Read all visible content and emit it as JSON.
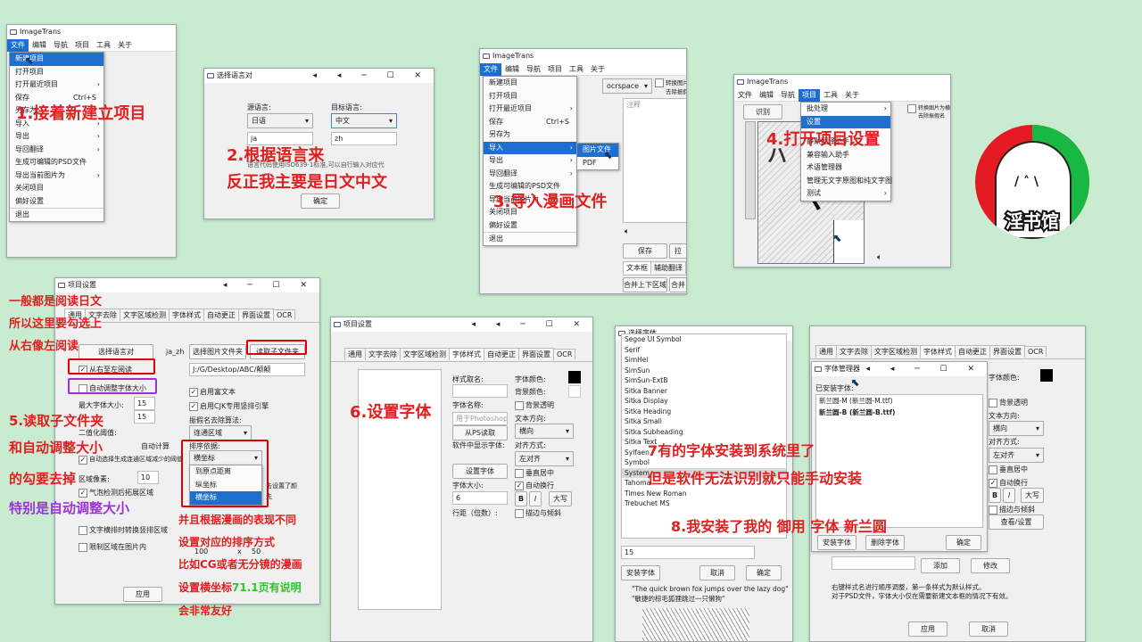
{
  "colors": {
    "background": "#c9ecd0",
    "annotation_red": "#e02020",
    "annotation_purple": "#9b30e0",
    "annotation_green": "#28c828",
    "menu_highlight": "#1e6fd0",
    "logo_red": "#e51b23",
    "logo_green": "#19b843"
  },
  "app": {
    "title": "ImageTrans"
  },
  "menubar": {
    "file": "文件",
    "edit": "编辑",
    "nav": "导航",
    "project": "项目",
    "tools": "工具",
    "about": "关于"
  },
  "file_menu": {
    "new_project": "新建项目",
    "open_project": "打开项目",
    "open_recent": "打开最近项目",
    "save": "保存",
    "save_shortcut": "Ctrl+S",
    "save_as": "另存为",
    "import": "导入",
    "export": "导出",
    "export_translation": "导回翻译",
    "gen_psd": "生成可编辑的PSD文件",
    "export_current_image": "导出当前图片为",
    "close_project": "关闭项目",
    "preferences": "偏好设置",
    "exit": "退出"
  },
  "import_submenu": {
    "image_file": "图片文件",
    "pdf": "PDF"
  },
  "project_menu": {
    "batch": "批处理",
    "settings": "设置",
    "static_helper": "静默翻译助手",
    "compat_helper": "兼容输入助手",
    "glossary": "术语管理器",
    "manage_no_text": "管理无文字原图和纯文字图",
    "test": "测试"
  },
  "lang_dialog": {
    "title": "选择语言对",
    "src_label": "源语言:",
    "tgt_label": "目标语言:",
    "src_value": "日语",
    "src_code": "ja",
    "tgt_value": "中文",
    "tgt_code": "zh",
    "hint_tail": "可以自行输入对应代",
    "hint_head": "语言代码使用ISO639-1标准,",
    "ok": "确定"
  },
  "win3": {
    "engine": "ocrspace",
    "chk1": "转换图片为",
    "chk2": "去除振假名",
    "note_label": "注释",
    "save_btn": "保存",
    "other_btn": "拉",
    "tab_textbox": "文本框",
    "tab_assist": "辅助翻译",
    "merge_btn": "合并上下区域",
    "merge2": "合并"
  },
  "win4": {
    "recognize": "识别",
    "chk1": "转换图片为横排",
    "chk2": "去除振假名",
    "chk3": "使用中",
    "chk4": "去除背"
  },
  "settings": {
    "title": "项目设置",
    "tabs": [
      "通用",
      "文字去除",
      "文字区域检测",
      "字体样式",
      "自动更正",
      "界面设置",
      "OCR"
    ],
    "select_lang_btn": "选择语言对",
    "lang_pair": "ja_zh",
    "select_folder_btn": "选择图片文件夹",
    "read_subfolder_btn": "读取子文件夹",
    "path": "J:/G/Desktop/ABC/颠颠",
    "rtl": "从右至左阅读",
    "auto_resize": "自动调整字体大小",
    "max_font": "最大字体大小:",
    "max_font_val": "15",
    "min_font_val": "15",
    "rich_text": "启用富文本",
    "cjk_vertical": "启用CJK专用竖排引擎",
    "sort_label": "振假名去除算法:",
    "binarize": "二值化阈值:",
    "auto_calc": "自动计算",
    "connected": "连通区域",
    "auto_choose": "自动选择生成连通区域减少的阈值",
    "sort_by": "排序依据:",
    "sort_options": [
      "横坐标",
      "到原点距离",
      "纵坐标",
      "横坐标"
    ],
    "region_px": "区域像素:",
    "region_val": "10",
    "bubble": "气泡检测后拓展区域",
    "textbox_convert": "文字横排时转换竖排区域",
    "limit_region": "限制区域在图片内",
    "apply": "应用",
    "val_100": "100",
    "val_x": "x",
    "val_50": "50",
    "extra_note": "击设置了颜",
    "extra_note2": "先"
  },
  "font_settings": {
    "style_name": "样式取名:",
    "font_color": "字体颜色:",
    "bg_color": "背景颜色:",
    "font_name": "字体名称:",
    "transparent_bg": "背景透明",
    "for_photoshop": "用于Photoshop",
    "text_dir": "文本方向:",
    "read_from_ps": "从PS读取",
    "horizontal": "横向",
    "software_font": "软件中显示字体:",
    "align": "对齐方式:",
    "align_val": "左对齐",
    "vcenter": "垂直居中",
    "set_font": "设置字体",
    "font_size": "字体大小:",
    "font_size_val": "6",
    "auto_wrap": "自动换行",
    "bold": "B",
    "italic": "I",
    "caps": "大写",
    "line_spacing": "行距（倍数）:",
    "stroke": "描边与倾斜"
  },
  "font_picker": {
    "title": "选择字体",
    "fonts": [
      "Segoe UI Symbol",
      "Serif",
      "SimHei",
      "SimSun",
      "SimSun-ExtB",
      "Sitka Banner",
      "Sitka Display",
      "Sitka Heading",
      "Sitka Small",
      "Sitka Subheading",
      "Sitka Text",
      "Sylfaen",
      "Symbol",
      "System",
      "Tahoma",
      "Times New Roman",
      "Trebuchet MS"
    ],
    "size_val": "15",
    "install_btn": "安装字体",
    "cancel": "取消",
    "ok": "确定",
    "sample1": "\"The quick brown fox jumps over the lazy dog\"",
    "sample2": "\"敏捷的棕毛狐狸跳过一只懒狗\""
  },
  "font_manager": {
    "title": "字体管理器",
    "installed": "已安装字体:",
    "items": [
      "新兰圆-M (新兰圆-M.ttf)",
      "新兰圆-B (新兰圆-B.ttf)"
    ],
    "install": "安装字体",
    "delete": "删除字体",
    "ok": "确定"
  },
  "font_win_bg": {
    "add": "添加",
    "modify": "修改",
    "view_settings": "查看/设置",
    "note1": "右键样式名进行顺序调整，第一条样式为默认样式。",
    "note2": "对于PSD文件，字体大小仅在需要新建文本框的情况下有效。",
    "apply": "应用",
    "cancel": "取消"
  },
  "annotations": {
    "step1": "1.接着新建立项目",
    "step2a": "2.根据语言来",
    "step2b": "反正我主要是日文中文",
    "step3": "3.导入漫画文件",
    "step4": "4.打开项目设置",
    "read_a": "一般都是阅读日文",
    "read_b": "所以这里要勾选上",
    "read_c": "从右像左阅读",
    "step5a": "5.读取子文件夹",
    "step5b": "和自动调整大小",
    "step5c": "的勾要去掉",
    "step5d": "特别是自动调整大小",
    "sort_a": "并且根据漫画的表现不同",
    "sort_b": "设置对应的排序方式",
    "sort_c": "比如CG或者无分镜的漫画",
    "sort_d": "设置横坐标",
    "sort_d_green": "71.1页有说明",
    "sort_e": "会非常友好",
    "step6": "6.设置字体",
    "step7a": "7有的字体安装到系统里了",
    "step7b": "但是软件无法识别就只能手动安装",
    "step8": "8.我安装了我的 御用 字体 新兰圆"
  },
  "logo": {
    "text": "淫书馆"
  },
  "manga": {
    "sfx1": "ヤ",
    "sfx2": "ハ"
  }
}
